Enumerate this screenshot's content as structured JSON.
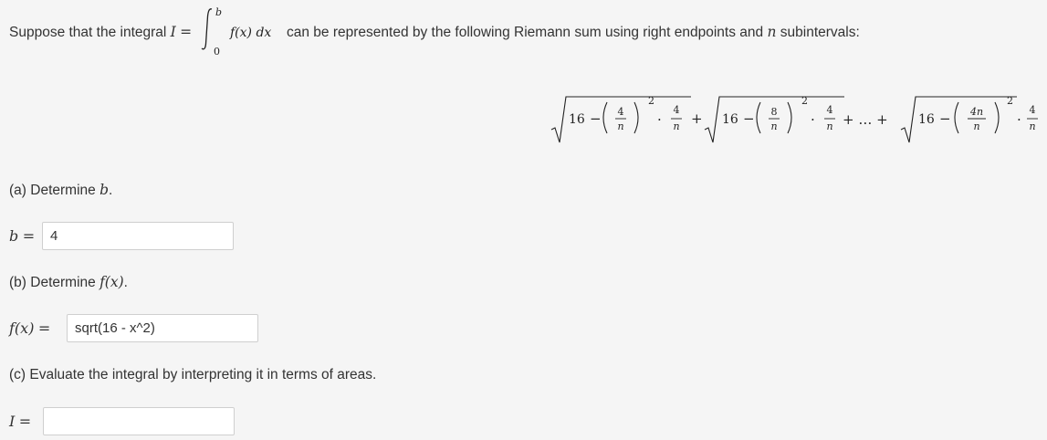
{
  "question": {
    "prefix": "Suppose that the integral",
    "integral": {
      "lhs": "I",
      "eq": "=",
      "upper": "b",
      "lower": "0",
      "integrand": "f(x) dx"
    },
    "suffix_1": "can be represented by the following Riemann sum using right endpoints and",
    "n_symbol": "n",
    "suffix_2": "subintervals:"
  },
  "riemann_sum": {
    "sqrt_const": "16",
    "minus": "−",
    "terms": [
      {
        "numerator": "4",
        "denominator": "n"
      },
      {
        "numerator": "8",
        "denominator": "n"
      },
      {
        "numerator": "4n",
        "denominator": "n"
      }
    ],
    "exponent": "2",
    "dot": "·",
    "dx_numerator": "4",
    "dx_denominator": "n",
    "plus": "+",
    "ellipsis": "+ … +"
  },
  "part_a": {
    "prompt_prefix": "(a) Determine",
    "prompt_var": "b",
    "prompt_suffix": ".",
    "label_var": "b",
    "label_eq": "=",
    "answer": "4"
  },
  "part_b": {
    "prompt_prefix": "(b) Determine",
    "prompt_var": "f(x)",
    "prompt_suffix": ".",
    "label_var": "f(x)",
    "label_eq": "=",
    "answer": "sqrt(16 - x^2)"
  },
  "part_c": {
    "prompt": "(c) Evaluate the integral by interpreting it in terms of areas.",
    "label_var": "I",
    "label_eq": "=",
    "answer": ""
  }
}
